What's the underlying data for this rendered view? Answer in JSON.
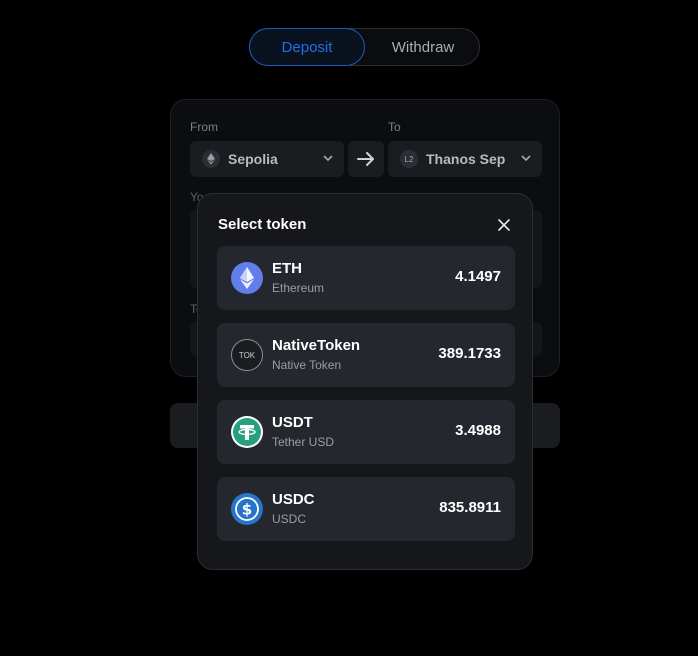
{
  "tabs": {
    "deposit": "Deposit",
    "withdraw": "Withdraw"
  },
  "bridge": {
    "from_label": "From",
    "to_label": "To",
    "from_network": "Sepolia",
    "to_network": "Thanos Sep",
    "to_network_badge": "L2",
    "amount_label_partial": "Yo",
    "to_address_label_partial": "To"
  },
  "modal": {
    "title": "Select token",
    "tokens": [
      {
        "symbol": "ETH",
        "name": "Ethereum",
        "balance": "4.1497",
        "icon": "ethereum-icon"
      },
      {
        "symbol": "NativeToken",
        "name": "Native Token",
        "balance": "389.1733",
        "icon": "tok-icon",
        "icon_text": "TOK"
      },
      {
        "symbol": "USDT",
        "name": "Tether USD",
        "balance": "3.4988",
        "icon": "tether-icon"
      },
      {
        "symbol": "USDC",
        "name": "USDC",
        "balance": "835.8911",
        "icon": "usdc-icon"
      }
    ]
  },
  "colors": {
    "accent": "#1f6fe6",
    "background": "#000000",
    "modal_bg": "#15171b",
    "row_bg": "#24272d",
    "eth": "#627eea",
    "usdt": "#26a17b",
    "usdc": "#2775ca"
  }
}
